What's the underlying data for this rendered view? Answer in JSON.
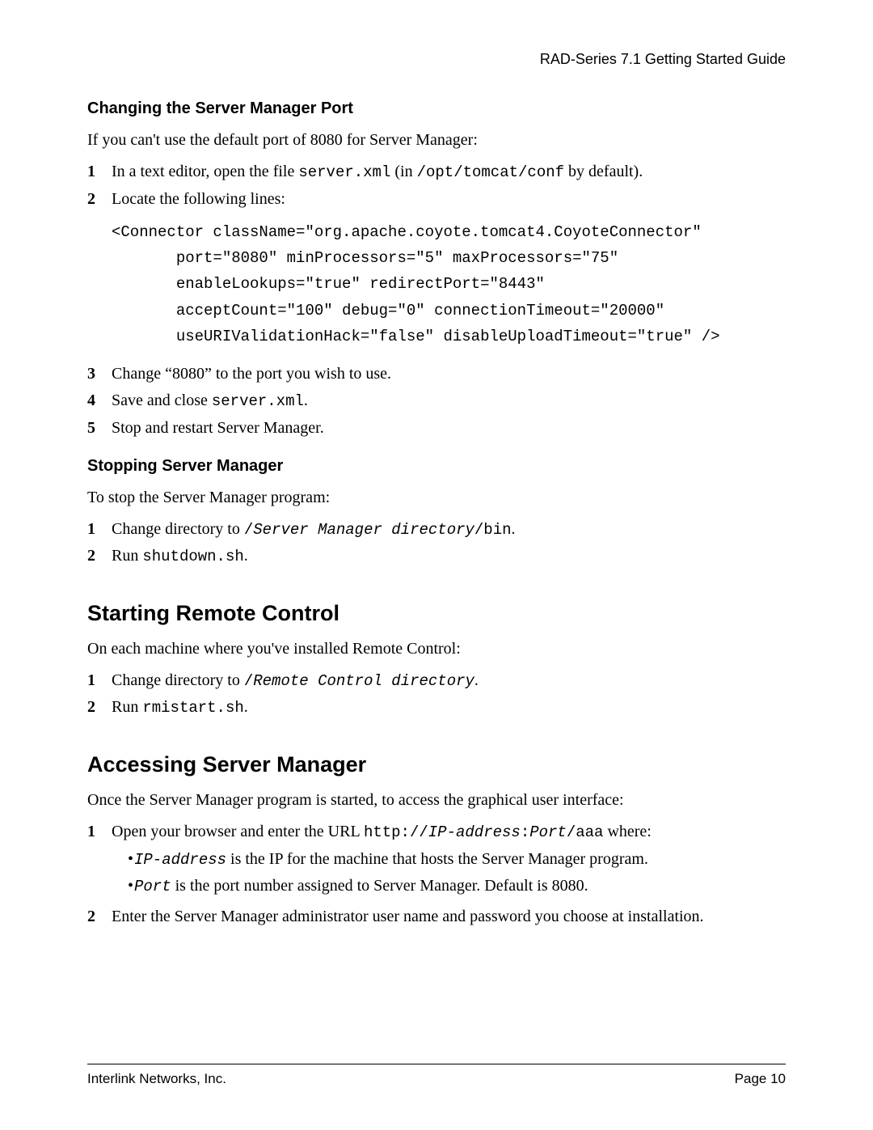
{
  "header": {
    "doc_title": "RAD-Series 7.1 Getting Started Guide"
  },
  "s1": {
    "heading": "Changing the Server Manager Port",
    "intro": "If you can't use the default port of 8080 for Server Manager:",
    "step1_a": "In a text editor, open the file ",
    "step1_code1": "server.xml",
    "step1_b": " (in ",
    "step1_code2": "/opt/tomcat/conf",
    "step1_c": " by default).",
    "step2": "Locate the following lines:",
    "codeblock": "<Connector className=\"org.apache.coyote.tomcat4.CoyoteConnector\"\n       port=\"8080\" minProcessors=\"5\" maxProcessors=\"75\"\n       enableLookups=\"true\" redirectPort=\"8443\"\n       acceptCount=\"100\" debug=\"0\" connectionTimeout=\"20000\"\n       useURIValidationHack=\"false\" disableUploadTimeout=\"true\" />",
    "step3": "Change “8080” to the port you wish to use.",
    "step4_a": "Save and close ",
    "step4_code": "server.xml",
    "step4_b": ".",
    "step5": "Stop and restart Server Manager."
  },
  "s2": {
    "heading": "Stopping Server Manager",
    "intro": "To stop the Server Manager program:",
    "step1_a": "Change directory to ",
    "step1_code_a": "/",
    "step1_code_i": "Server Manager directory",
    "step1_code_b": "/bin",
    "step1_b": ".",
    "step2_a": "Run ",
    "step2_code": "shutdown.sh",
    "step2_b": "."
  },
  "s3": {
    "heading": "Starting Remote Control",
    "intro": "On each machine where you've installed Remote Control:",
    "step1_a": "Change directory to ",
    "step1_code_a": "/",
    "step1_code_i": "Remote Control directory",
    "step1_b": ".",
    "step2_a": "Run ",
    "step2_code": "rmistart.sh",
    "step2_b": "."
  },
  "s4": {
    "heading": "Accessing Server Manager",
    "intro": "Once the Server Manager program is started, to access the graphical user interface:",
    "step1_a": "Open your browser and enter the URL ",
    "step1_code_a": "http://",
    "step1_code_i1": "IP-address",
    "step1_code_b": ":",
    "step1_code_i2": "Port",
    "step1_code_c": "/aaa",
    "step1_b": " where:",
    "bullet1_code": "IP-address",
    "bullet1_text": " is the IP for the machine that hosts the Server Manager program.",
    "bullet2_code": "Port",
    "bullet2_text": " is the port number assigned to Server Manager. Default is 8080.",
    "step2": "Enter the Server Manager administrator user name and password you choose at installation."
  },
  "footer": {
    "left": "Interlink Networks, Inc.",
    "right": "Page 10"
  },
  "nums": {
    "1": "1",
    "2": "2",
    "3": "3",
    "4": "4",
    "5": "5"
  },
  "dot": "•"
}
